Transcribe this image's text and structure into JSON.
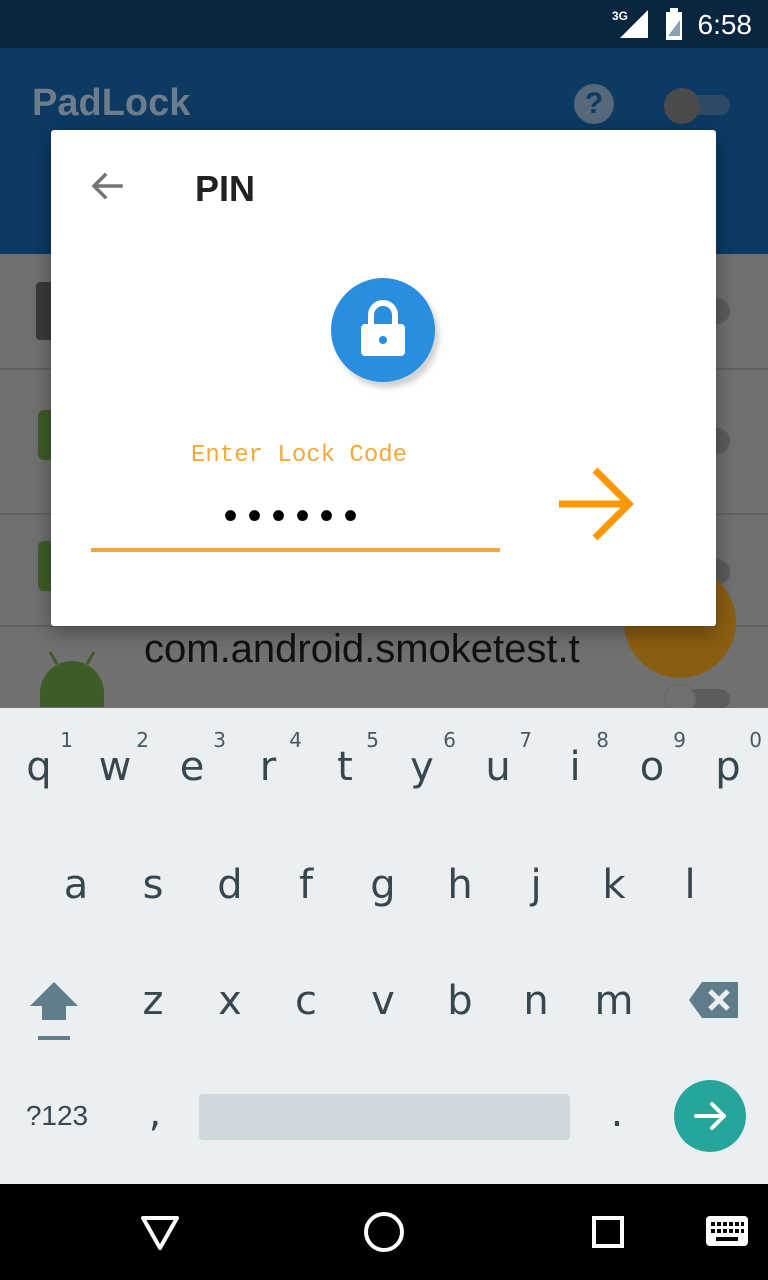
{
  "status_bar": {
    "network": "3G",
    "time": "6:58"
  },
  "app": {
    "title": "PadLock",
    "help_icon": "question-circle-icon",
    "list_items": [
      {
        "label": "com.android.smoketest.t"
      }
    ]
  },
  "dialog": {
    "title": "PIN",
    "lock_code_label": "Enter Lock Code",
    "lock_code_value": "••••••",
    "accent_color": "#f2a93b",
    "lock_color": "#2a8ee0"
  },
  "keyboard": {
    "row_q": [
      {
        "ch": "q",
        "hint": "1"
      },
      {
        "ch": "w",
        "hint": "2"
      },
      {
        "ch": "e",
        "hint": "3"
      },
      {
        "ch": "r",
        "hint": "4"
      },
      {
        "ch": "t",
        "hint": "5"
      },
      {
        "ch": "y",
        "hint": "6"
      },
      {
        "ch": "u",
        "hint": "7"
      },
      {
        "ch": "i",
        "hint": "8"
      },
      {
        "ch": "o",
        "hint": "9"
      },
      {
        "ch": "p",
        "hint": "0"
      }
    ],
    "row_a": [
      "a",
      "s",
      "d",
      "f",
      "g",
      "h",
      "j",
      "k",
      "l"
    ],
    "row_z": [
      "z",
      "x",
      "c",
      "v",
      "b",
      "n",
      "m"
    ],
    "symbols_label": "?123",
    "comma": ",",
    "period": ".",
    "enter_color": "#26a69a"
  }
}
